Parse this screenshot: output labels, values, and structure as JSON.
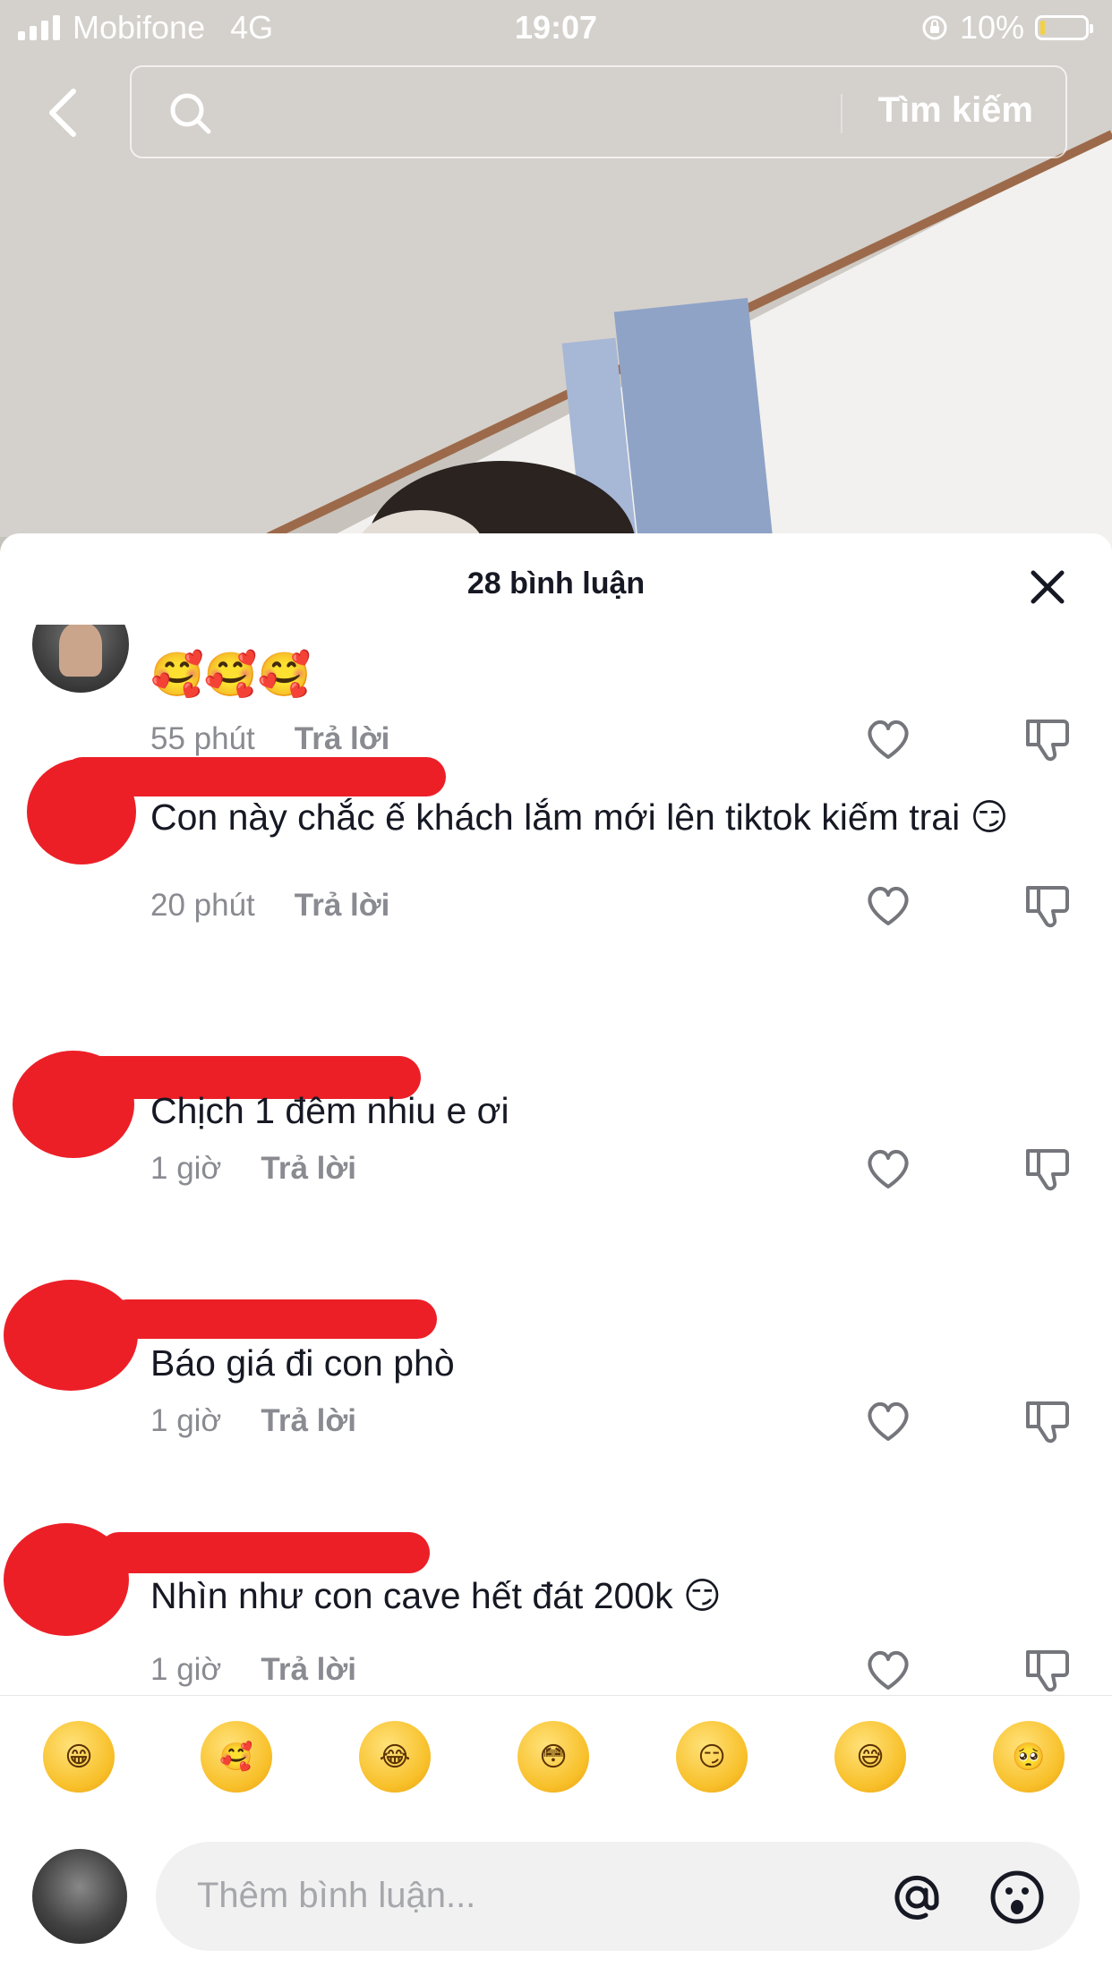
{
  "status_bar": {
    "carrier": "Mobifone",
    "network": "4G",
    "time": "19:07",
    "battery": "10%"
  },
  "header": {
    "search_button": "Tìm kiếm",
    "search_placeholder": ""
  },
  "sheet": {
    "title": "28 bình luận"
  },
  "comments": [
    {
      "text": "🥰🥰🥰",
      "time": "55 phút",
      "reply": "Trả lời",
      "redacted": false
    },
    {
      "text": "Con này chắc ế khách lắm mới lên tiktok kiếm trai 😏",
      "time": "20 phút",
      "reply": "Trả lời",
      "redacted": true
    },
    {
      "text": "Chịch 1 đêm nhiu e ơi",
      "time": "1 giờ",
      "reply": "Trả lời",
      "redacted": true
    },
    {
      "text": "Báo giá đi con phò",
      "time": "1 giờ",
      "reply": "Trả lời",
      "redacted": true
    },
    {
      "text": "Nhìn như con cave hết đát 200k 😏",
      "time": "1 giờ",
      "reply": "Trả lời",
      "redacted": true
    }
  ],
  "quick_emojis": [
    "😁",
    "🥰",
    "😂",
    "😳",
    "😏",
    "😅",
    "🥺"
  ],
  "input": {
    "placeholder": "Thêm bình luận..."
  },
  "colors": {
    "accent_text": "#161823",
    "meta_text": "#8a8b91",
    "redaction": "#ec1f27",
    "battery_fill": "#f5d142"
  }
}
